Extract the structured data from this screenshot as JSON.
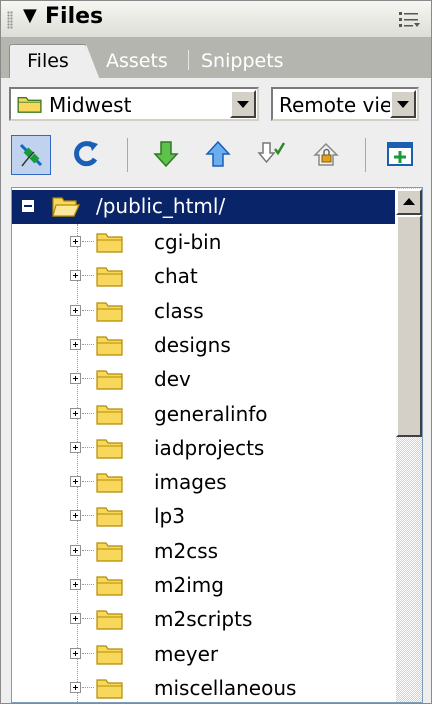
{
  "panel": {
    "title": "Files",
    "collapse_glyph": "▼",
    "options_icon": "panel-options-icon"
  },
  "tabs": [
    {
      "label": "Files",
      "active": true
    },
    {
      "label": "Assets",
      "active": false
    },
    {
      "label": "Snippets",
      "active": false
    }
  ],
  "site_select": {
    "value": "Midwest",
    "icon": "folder-icon"
  },
  "view_select": {
    "value": "Remote vie"
  },
  "toolbar": {
    "buttons": [
      {
        "name": "connect-button",
        "icon": "connect-plug-icon",
        "active": true
      },
      {
        "name": "refresh-button",
        "icon": "refresh-icon"
      },
      {
        "name": "get-files-button",
        "icon": "down-arrow-icon"
      },
      {
        "name": "put-files-button",
        "icon": "up-arrow-icon"
      },
      {
        "name": "check-out-button",
        "icon": "checkout-icon"
      },
      {
        "name": "check-in-button",
        "icon": "checkin-lock-icon"
      },
      {
        "name": "expand-button",
        "icon": "expand-view-icon"
      }
    ]
  },
  "tree": {
    "root": {
      "label": "/public_html/",
      "expanded": true
    },
    "folders": [
      "cgi-bin",
      "chat",
      "class",
      "designs",
      "dev",
      "generalinfo",
      "iadprojects",
      "images",
      "lp3",
      "m2css",
      "m2img",
      "m2scripts",
      "meyer",
      "miscellaneous"
    ]
  },
  "colors": {
    "selection": "#0a246a",
    "folder_fill": "#f8d85c",
    "folder_stroke": "#b58b00",
    "tab_bar": "#b5b5b0",
    "panel_bg": "#eeeeee"
  }
}
